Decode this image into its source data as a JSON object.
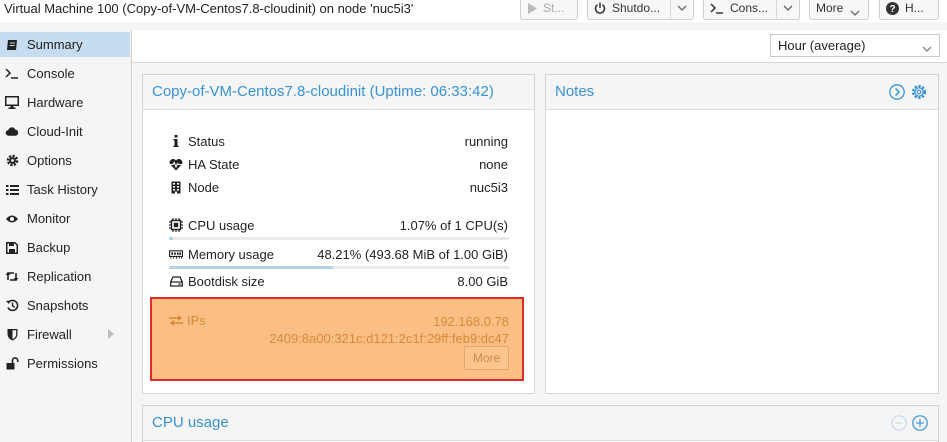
{
  "window": {
    "title": "Virtual Machine 100 (Copy-of-VM-Centos7.8-cloudinit) on node 'nuc5i3'"
  },
  "toolbar": {
    "start_label": "St...",
    "shutdown_label": "Shutdo...",
    "console_label": "Cons...",
    "more_label": "More",
    "help_label": "H..."
  },
  "sidebar": {
    "items": [
      {
        "label": "Summary",
        "icon": "book-icon",
        "active": true
      },
      {
        "label": "Console",
        "icon": "terminal-icon"
      },
      {
        "label": "Hardware",
        "icon": "desktop-icon"
      },
      {
        "label": "Cloud-Init",
        "icon": "cloud-icon"
      },
      {
        "label": "Options",
        "icon": "gear-icon"
      },
      {
        "label": "Task History",
        "icon": "list-icon"
      },
      {
        "label": "Monitor",
        "icon": "eye-icon"
      },
      {
        "label": "Backup",
        "icon": "floppy-icon"
      },
      {
        "label": "Replication",
        "icon": "retweet-icon"
      },
      {
        "label": "Snapshots",
        "icon": "history-icon"
      },
      {
        "label": "Firewall",
        "icon": "shield-icon"
      },
      {
        "label": "Permissions",
        "icon": "unlock-icon"
      }
    ]
  },
  "timeframe": {
    "value": "Hour (average)"
  },
  "summary": {
    "title": "Copy-of-VM-Centos7.8-cloudinit (Uptime: 06:33:42)",
    "status": {
      "label": "Status",
      "value": "running"
    },
    "ha_state": {
      "label": "HA State",
      "value": "none"
    },
    "node": {
      "label": "Node",
      "value": "nuc5i3"
    },
    "cpu": {
      "label": "CPU usage",
      "value": "1.07% of 1 CPU(s)",
      "fraction": 0.0107
    },
    "memory": {
      "label": "Memory usage",
      "value": "48.21% (493.68 MiB of 1.00 GiB)",
      "fraction": 0.4821
    },
    "bootdisk": {
      "label": "Bootdisk size",
      "value": "8.00 GiB"
    },
    "ips": {
      "label": "IPs",
      "ipv4": "192.168.0.78",
      "ipv6": "2409:8a00:321c:d121:2c1f:29ff:feb9:dc47",
      "more_label": "More"
    }
  },
  "notes": {
    "title": "Notes"
  },
  "cpu_panel": {
    "title": "CPU usage"
  },
  "colors": {
    "accent": "#3892d4",
    "active_nav": "#c6dcef",
    "ips_highlight": "#fbbf84",
    "ips_border": "#e02b27"
  }
}
